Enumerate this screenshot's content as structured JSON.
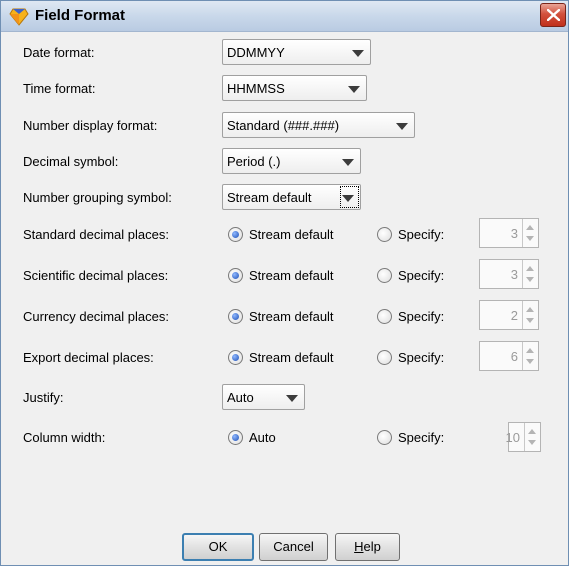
{
  "window": {
    "title": "Field Format",
    "icon": "diamond-app-icon",
    "close_icon": "close-icon"
  },
  "fields": {
    "date_format": {
      "label": "Date format:",
      "value": "DDMMYY"
    },
    "time_format": {
      "label": "Time format:",
      "value": "HHMMSS"
    },
    "number_display_format": {
      "label": "Number display format:",
      "value": "Standard (###.###)"
    },
    "decimal_symbol": {
      "label": "Decimal symbol:",
      "value": "Period (.)"
    },
    "number_grouping_symbol": {
      "label": "Number grouping symbol:",
      "value": "Stream default"
    },
    "justify": {
      "label": "Justify:",
      "value": "Auto"
    }
  },
  "decimal_rows": [
    {
      "label": "Standard decimal places:",
      "option1": "Stream default",
      "option2": "Specify:",
      "selected": "option1",
      "value": "3"
    },
    {
      "label": "Scientific decimal places:",
      "option1": "Stream default",
      "option2": "Specify:",
      "selected": "option1",
      "value": "3"
    },
    {
      "label": "Currency decimal places:",
      "option1": "Stream default",
      "option2": "Specify:",
      "selected": "option1",
      "value": "2"
    },
    {
      "label": "Export decimal places:",
      "option1": "Stream default",
      "option2": "Specify:",
      "selected": "option1",
      "value": "6"
    }
  ],
  "column_width": {
    "label": "Column width:",
    "option1": "Auto",
    "option2": "Specify:",
    "selected": "option1",
    "value": "10"
  },
  "buttons": {
    "ok": "OK",
    "cancel": "Cancel",
    "help_prefix": "",
    "help_mnemonic": "H",
    "help_rest": "elp"
  },
  "colors": {
    "title_bg": "#c9d8ea",
    "dialog_bg": "#f0f0f0",
    "radio_selected": "#1e4fb4",
    "close_red": "#c0301c"
  }
}
